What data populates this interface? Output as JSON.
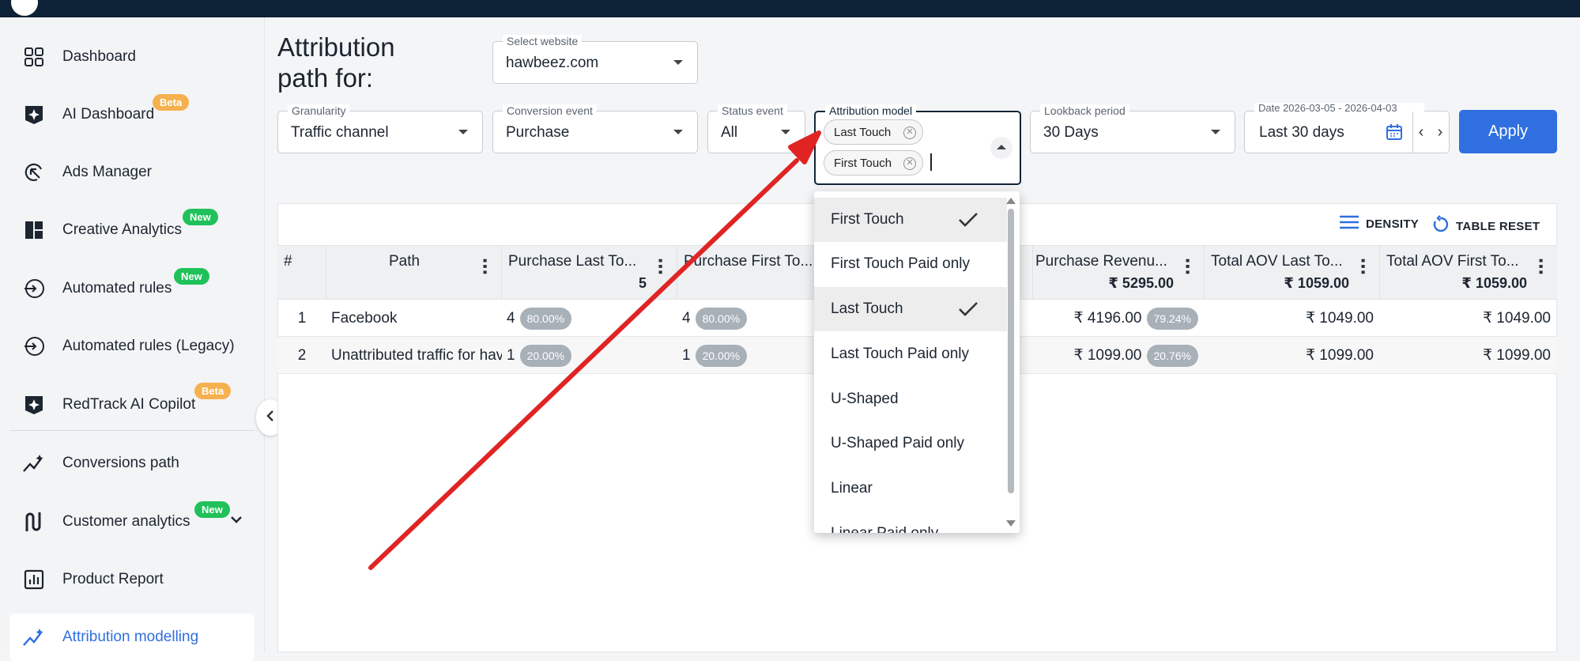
{
  "sidebar": {
    "items": [
      {
        "label": "Dashboard",
        "icon": "grid-icon"
      },
      {
        "label": "AI Dashboard",
        "icon": "ai-spark-icon",
        "badge": "Beta"
      },
      {
        "label": "Ads Manager",
        "icon": "cursor-click-icon"
      },
      {
        "label": "Creative Analytics",
        "icon": "layout-blocks-icon",
        "badge": "New"
      },
      {
        "label": "Automated rules",
        "icon": "enter-arrow-icon",
        "badge": "New"
      },
      {
        "label": "Automated rules (Legacy)",
        "icon": "enter-arrow-icon"
      },
      {
        "label": "RedTrack AI Copilot",
        "icon": "ai-spark-icon",
        "badge": "Beta"
      },
      {
        "label": "Conversions path",
        "icon": "trend-spark-icon"
      },
      {
        "label": "Customer analytics",
        "icon": "funnel-path-icon",
        "badge": "New"
      },
      {
        "label": "Product Report",
        "icon": "bar-report-icon"
      },
      {
        "label": "Attribution modelling",
        "icon": "trend-spark-icon"
      }
    ]
  },
  "header": {
    "title": "Attribution path for:",
    "website": {
      "label": "Select website",
      "value": "hawbeez.com"
    }
  },
  "filters": {
    "granularity": {
      "label": "Granularity",
      "value": "Traffic channel"
    },
    "conversion_event": {
      "label": "Conversion event",
      "value": "Purchase"
    },
    "status_event": {
      "label": "Status event",
      "value": "All"
    },
    "attribution_model": {
      "label": "Attribution model",
      "chips": [
        "Last Touch",
        "First Touch"
      ]
    },
    "lookback": {
      "label": "Lookback period",
      "value": "30 Days"
    },
    "date": {
      "label": "Date 2026-03-05 - 2026-04-03",
      "value": "Last 30 days"
    },
    "apply_label": "Apply"
  },
  "toolbar": {
    "density": "DENSITY",
    "reset": "TABLE RESET"
  },
  "table": {
    "columns": [
      {
        "title": "#",
        "total": ""
      },
      {
        "title": "Path",
        "total": ""
      },
      {
        "title": "Purchase Last To...",
        "total": "5"
      },
      {
        "title": "Purchase First To...",
        "total": ""
      },
      {
        "title": "Purchase Revenu...",
        "total": "₹ 5295.00"
      },
      {
        "title": "Total AOV Last To...",
        "total": "₹ 1059.00"
      },
      {
        "title": "Total AOV First To...",
        "total": "₹ 1059.00"
      }
    ],
    "rows": [
      {
        "n": "1",
        "path": "Facebook",
        "last": "4",
        "last_pct": "80.00%",
        "first": "4",
        "first_pct": "80.00%",
        "rev": "₹ 4196.00",
        "rev_pct": "79.24%",
        "aov_last": "₹ 1049.00",
        "aov_first": "₹ 1049.00"
      },
      {
        "n": "2",
        "path": "Unattributed traffic for hav",
        "last": "1",
        "last_pct": "20.00%",
        "first": "1",
        "first_pct": "20.00%",
        "rev": "₹ 1099.00",
        "rev_pct": "20.76%",
        "aov_last": "₹ 1099.00",
        "aov_first": "₹ 1099.00"
      }
    ]
  },
  "dropdown": {
    "options": [
      {
        "label": "First Touch",
        "selected": true
      },
      {
        "label": "First Touch Paid only",
        "selected": false
      },
      {
        "label": "Last Touch",
        "selected": true
      },
      {
        "label": "Last Touch Paid only",
        "selected": false
      },
      {
        "label": "U-Shaped",
        "selected": false
      },
      {
        "label": "U-Shaped Paid only",
        "selected": false
      },
      {
        "label": "Linear",
        "selected": false
      },
      {
        "label": "Linear Paid only",
        "selected": false
      }
    ]
  },
  "colors": {
    "accent": "#2f6fe0",
    "topbar": "#0e2237",
    "annotation_arrow": "#e02424"
  }
}
